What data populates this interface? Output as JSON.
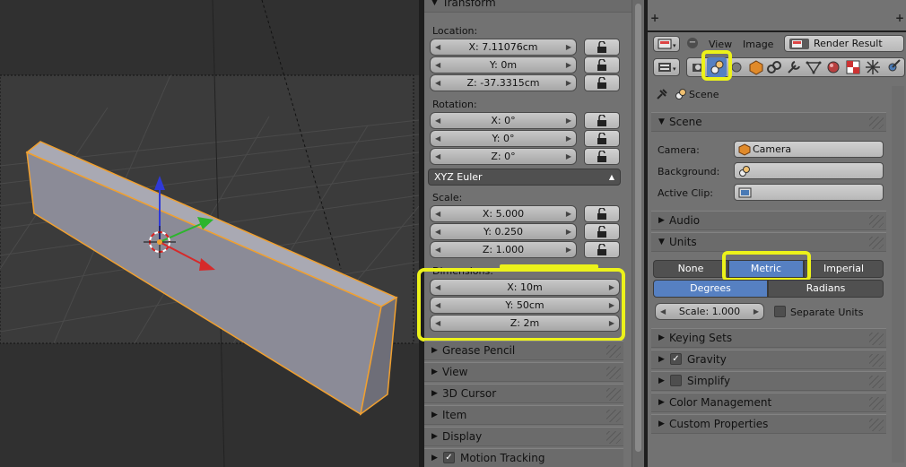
{
  "transform_panel": {
    "header": "Transform",
    "location_label": "Location:",
    "location": [
      "X: 7.11076cm",
      "Y: 0m",
      "Z: -37.3315cm"
    ],
    "rotation_label": "Rotation:",
    "rotation": [
      "X: 0°",
      "Y: 0°",
      "Z: 0°"
    ],
    "rotation_mode": "XYZ Euler",
    "scale_label": "Scale:",
    "scale": [
      "X: 5.000",
      "Y: 0.250",
      "Z: 1.000"
    ],
    "dimensions_label": "Dimensions:",
    "dimensions": [
      "X: 10m",
      "Y: 50cm",
      "Z: 2m"
    ]
  },
  "npanel_sections": [
    "Grease Pencil",
    "View",
    "3D Cursor",
    "Item",
    "Display",
    "Motion Tracking"
  ],
  "properties": {
    "header_view": "View",
    "header_image": "Image",
    "render_result": "Render Result",
    "breadcrumb": "Scene",
    "scene_panel": {
      "header": "Scene",
      "camera_label": "Camera:",
      "camera_value": "Camera",
      "background_label": "Background:",
      "active_clip_label": "Active Clip:"
    },
    "audio_header": "Audio",
    "units_panel": {
      "header": "Units",
      "systems": [
        "None",
        "Metric",
        "Imperial"
      ],
      "rotation_units": [
        "Degrees",
        "Radians"
      ],
      "scale": "Scale: 1.000",
      "separate_units": "Separate Units"
    },
    "keying_sets": "Keying Sets",
    "gravity": "Gravity",
    "simplify": "Simplify",
    "color_management": "Color Management",
    "custom_properties": "Custom Properties"
  },
  "colors": {
    "highlight": "#ecf21a",
    "selected_blue": "#5680c2",
    "object_outline": "#f0a030"
  }
}
